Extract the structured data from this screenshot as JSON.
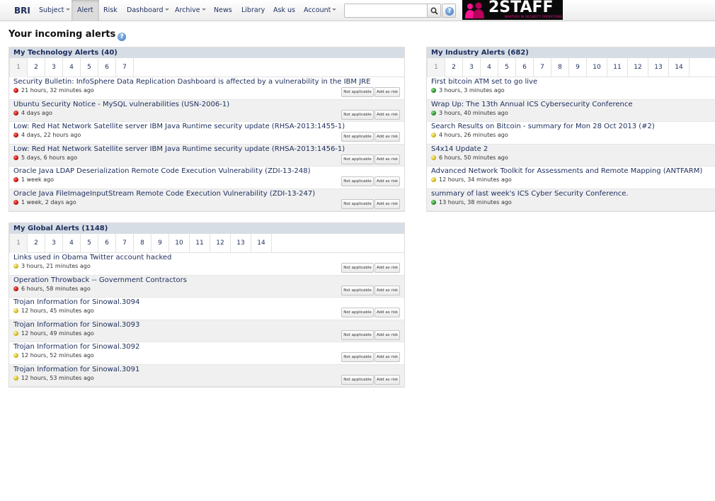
{
  "nav": {
    "brand": "BRI",
    "items": [
      {
        "label": "Subject",
        "dropdown": true
      },
      {
        "label": "Alert",
        "active": true
      },
      {
        "label": "Risk"
      },
      {
        "label": "Dashboard",
        "dropdown": true
      },
      {
        "label": "Archive",
        "dropdown": true
      },
      {
        "label": "News"
      },
      {
        "label": "Library"
      },
      {
        "label": "Ask us"
      },
      {
        "label": "Account",
        "dropdown": true
      }
    ],
    "search": {
      "value": "",
      "placeholder": ""
    },
    "logo": {
      "text_main": "2STAFF",
      "tagline": "MASTERS IN SECURITY OPERATIONS"
    }
  },
  "page": {
    "title": "Your incoming alerts"
  },
  "buttons": {
    "not_applicable": "Not applicable",
    "add_as_risk": "Add as risk"
  },
  "tech": {
    "title": "My Technology Alerts (40)",
    "pages": [
      "1",
      "2",
      "3",
      "4",
      "5",
      "6",
      "7"
    ],
    "alerts": [
      {
        "title": "Security Bulletin: InfoSphere Data Replication Dashboard is affected by a vulnerability in the IBM JRE",
        "time": "21 hours, 32 minutes ago",
        "level": "red"
      },
      {
        "title": "Ubuntu Security Notice - MySQL vulnerabilities (USN-2006-1)",
        "time": "4 days ago",
        "level": "red"
      },
      {
        "title": "Low: Red Hat Network Satellite server IBM Java Runtime security update (RHSA-2013:1455-1)",
        "time": "4 days, 22 hours ago",
        "level": "red"
      },
      {
        "title": "Low: Red Hat Network Satellite server IBM Java Runtime security update (RHSA-2013:1456-1)",
        "time": "5 days, 6 hours ago",
        "level": "red"
      },
      {
        "title": "Oracle Java LDAP Deserialization Remote Code Execution Vulnerability (ZDI-13-248)",
        "time": "1 week ago",
        "level": "red"
      },
      {
        "title": "Oracle Java FileImageInputStream Remote Code Execution Vulnerability (ZDI-13-247)",
        "time": "1 week, 2 days ago",
        "level": "red"
      }
    ]
  },
  "industry": {
    "title": "My Industry Alerts (682)",
    "pages": [
      "1",
      "2",
      "3",
      "4",
      "5",
      "6",
      "7",
      "8",
      "9",
      "10",
      "11",
      "12",
      "13",
      "14"
    ],
    "alerts": [
      {
        "title": "First bitcoin ATM set to go live",
        "time": "3 hours, 3 minutes ago",
        "level": "green"
      },
      {
        "title": "Wrap Up: The 13th Annual ICS Cybersecurity Conference",
        "time": "3 hours, 40 minutes ago",
        "level": "green"
      },
      {
        "title": "Search Results on Bitcoin - summary for Mon 28 Oct 2013 (#2)",
        "time": "4 hours, 26 minutes ago",
        "level": "yellow"
      },
      {
        "title": "S4x14 Update 2",
        "time": "6 hours, 50 minutes ago",
        "level": "yellow"
      },
      {
        "title": "Advanced Network Toolkit for Assessments and Remote Mapping (ANTFARM)",
        "time": "12 hours, 34 minutes ago",
        "level": "yellow"
      },
      {
        "title": "summary of last week's ICS Cyber Security Conference.",
        "time": "13 hours, 38 minutes ago",
        "level": "green"
      }
    ]
  },
  "global": {
    "title": "My Global Alerts (1148)",
    "pages": [
      "1",
      "2",
      "3",
      "4",
      "5",
      "6",
      "7",
      "8",
      "9",
      "10",
      "11",
      "12",
      "13",
      "14"
    ],
    "alerts": [
      {
        "title": "Links used in Obama Twitter account hacked",
        "time": "3 hours, 21 minutes ago",
        "level": "yellow"
      },
      {
        "title": "Operation Throwback -- Government Contractors",
        "time": "6 hours, 58 minutes ago",
        "level": "red"
      },
      {
        "title": "Trojan Information for Sinowal.3094",
        "time": "12 hours, 45 minutes ago",
        "level": "yellow"
      },
      {
        "title": "Trojan Information for Sinowal.3093",
        "time": "12 hours, 49 minutes ago",
        "level": "yellow"
      },
      {
        "title": "Trojan Information for Sinowal.3092",
        "time": "12 hours, 52 minutes ago",
        "level": "yellow"
      },
      {
        "title": "Trojan Information for Sinowal.3091",
        "time": "12 hours, 53 minutes ago",
        "level": "yellow"
      }
    ]
  }
}
